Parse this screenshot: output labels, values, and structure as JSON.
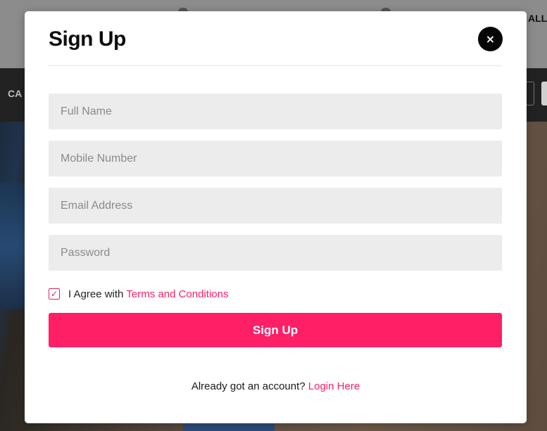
{
  "background": {
    "nav_text": "CA",
    "top_text": "ALL"
  },
  "modal": {
    "title": "Sign Up",
    "close_label": "×",
    "fields": {
      "full_name": {
        "placeholder": "Full Name",
        "value": ""
      },
      "mobile": {
        "placeholder": "Mobile Number",
        "value": ""
      },
      "email": {
        "placeholder": "Email Address",
        "value": ""
      },
      "password": {
        "placeholder": "Password",
        "value": ""
      }
    },
    "agree": {
      "checked": true,
      "check_mark": "✓",
      "text": "I Agree with",
      "link": "Terms and Conditions"
    },
    "submit_label": "Sign Up",
    "login": {
      "text": "Already got an account?",
      "link": "Login Here"
    }
  },
  "colors": {
    "accent": "#ff1f66",
    "field_bg": "#ececec",
    "close_bg": "#050505"
  }
}
